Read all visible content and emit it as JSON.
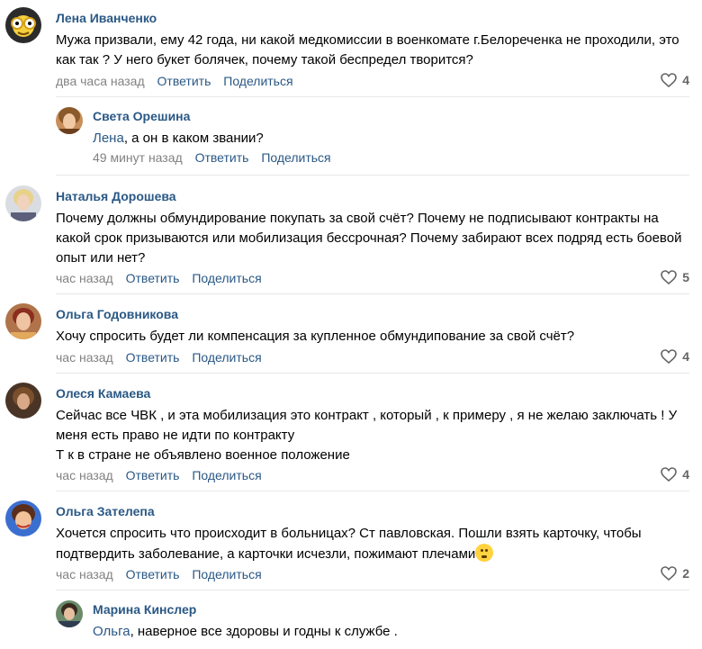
{
  "actions": {
    "reply": "Ответить",
    "share": "Поделиться"
  },
  "colors": {
    "link": "#2a5885",
    "meta": "#828282",
    "divider": "#e7e8ec",
    "heart": "#656565"
  },
  "comments": [
    {
      "author": "Лена Иванченко",
      "text": "Мужа призвали, ему 42 года, ни какой медкомиссии в военкомате г.Белореченка не проходили, это как так ? У него букет болячек, почему такой беспредел творится?",
      "time": "два часа назад",
      "likes": "4",
      "reply": {
        "author": "Света Орешина",
        "mention": "Лена",
        "text": ", а он в каком звании?",
        "time": "49 минут назад"
      }
    },
    {
      "author": "Наталья Дорошева",
      "text": "Почему должны обмундирование покупать за свой счёт? Почему не подписывают контракты на какой срок призываются или мобилизация бессрочная? Почему забирают всех подряд есть боевой опыт или нет?",
      "time": "час назад",
      "likes": "5"
    },
    {
      "author": "Ольга Годовникова",
      "text": "Хочу спросить будет ли компенсация за купленное обмундипование за свой счёт?",
      "time": "час назад",
      "likes": "4"
    },
    {
      "author": "Олеся Камаева",
      "lines": [
        "Сейчас все ЧВК , и эта мобилизация это контракт , который , к примеру , я не желаю заключать ! У меня есть право не идти по контракту",
        "Т к в стране не объявлено военное положение"
      ],
      "time": "час назад",
      "likes": "4"
    },
    {
      "author": "Ольга Зателепа",
      "text": "Хочется спросить что происходит в больницах? Ст павловская. Пошли взять карточку, чтобы подтвердить заболевание, а карточки исчезли, пожимают плечами",
      "emoji": "thinking-face",
      "time": "час назад",
      "likes": "2",
      "reply": {
        "author": "Марина Кинслер",
        "mention": "Ольга",
        "text": ", наверное все здоровы и годны к службе ."
      }
    }
  ]
}
